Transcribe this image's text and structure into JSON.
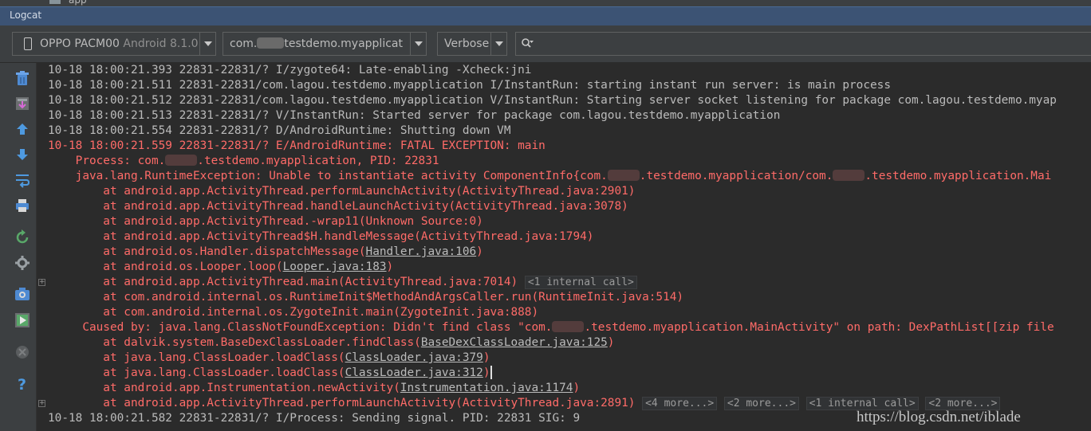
{
  "top_strip": {
    "label": "app"
  },
  "window_title": "Logcat",
  "toolbar": {
    "device": {
      "name": "OPPO PACM00",
      "api": "Android 8.1.0"
    },
    "process": {
      "prefix": "com.",
      "suffix": "testdemo.myapplicat"
    },
    "log_level": "Verbose",
    "search": {
      "value": "",
      "placeholder": ""
    }
  },
  "sidebar": {
    "tools": [
      {
        "name": "trash-icon"
      },
      {
        "name": "scroll-to-end-icon"
      },
      {
        "name": "up-arrow-icon"
      },
      {
        "name": "down-arrow-icon"
      },
      {
        "name": "soft-wraps-icon"
      },
      {
        "name": "print-icon"
      },
      {
        "name": "restart-icon"
      },
      {
        "name": "gear-icon"
      },
      {
        "name": "screenshot-icon"
      },
      {
        "name": "screen-record-icon"
      },
      {
        "name": "close-icon"
      },
      {
        "name": "help-icon"
      }
    ]
  },
  "colors": {
    "error": "#ff6b68",
    "info": "#bbbbbb",
    "background": "#2b2b2b",
    "title_bar": "#3c5374"
  },
  "log_lines": [
    {
      "level": "I",
      "segments": [
        {
          "t": "10-18 18:00:21.393 22831-22831/? I/zygote64: Late-enabling -Xcheck:jni"
        }
      ]
    },
    {
      "level": "I",
      "segments": [
        {
          "t": "10-18 18:00:21.511 22831-22831/com.lagou.testdemo.myapplication I/InstantRun: starting instant run server: is main process"
        }
      ]
    },
    {
      "level": "V",
      "segments": [
        {
          "t": "10-18 18:00:21.512 22831-22831/com.lagou.testdemo.myapplication V/InstantRun: Starting server socket listening for package com.lagou.testdemo.myap"
        }
      ]
    },
    {
      "level": "V",
      "segments": [
        {
          "t": "10-18 18:00:21.513 22831-22831/? V/InstantRun: Started server for package com.lagou.testdemo.myapplication"
        }
      ]
    },
    {
      "level": "D",
      "segments": [
        {
          "t": "10-18 18:00:21.554 22831-22831/? D/AndroidRuntime: Shutting down VM"
        }
      ]
    },
    {
      "level": "E",
      "segments": [
        {
          "t": "10-18 18:00:21.559 22831-22831/? E/AndroidRuntime: FATAL EXCEPTION: main"
        }
      ]
    },
    {
      "level": "E",
      "segments": [
        {
          "t": "    Process: com."
        },
        {
          "redacted": true
        },
        {
          "t": ".testdemo.myapplication, PID: 22831"
        }
      ]
    },
    {
      "level": "E",
      "segments": [
        {
          "t": "    java.lang.RuntimeException: Unable to instantiate activity ComponentInfo{com."
        },
        {
          "redacted": true
        },
        {
          "t": ".testdemo.myapplication/com."
        },
        {
          "redacted": true
        },
        {
          "t": ".testdemo.myapplication.Mai"
        }
      ]
    },
    {
      "level": "E",
      "segments": [
        {
          "t": "        at android.app.ActivityThread.performLaunchActivity(ActivityThread.java:2901)"
        }
      ]
    },
    {
      "level": "E",
      "segments": [
        {
          "t": "        at android.app.ActivityThread.handleLaunchActivity(ActivityThread.java:3078)"
        }
      ]
    },
    {
      "level": "E",
      "segments": [
        {
          "t": "        at android.app.ActivityThread.-wrap11(Unknown Source:0)"
        }
      ]
    },
    {
      "level": "E",
      "segments": [
        {
          "t": "        at android.app.ActivityThread$H.handleMessage(ActivityThread.java:1794)"
        }
      ]
    },
    {
      "level": "E",
      "segments": [
        {
          "t": "        at android.os.Handler.dispatchMessage("
        },
        {
          "t": "Handler.java:106",
          "link": true
        },
        {
          "t": ")"
        }
      ]
    },
    {
      "level": "E",
      "segments": [
        {
          "t": "        at android.os.Looper.loop("
        },
        {
          "t": "Looper.java:183",
          "link": true
        },
        {
          "t": ")"
        }
      ]
    },
    {
      "level": "E",
      "fold": true,
      "segments": [
        {
          "t": "        at android.app.ActivityThread.main(ActivityThread.java:7014) "
        },
        {
          "t": "<1 internal call>",
          "tag": true
        }
      ]
    },
    {
      "level": "E",
      "segments": [
        {
          "t": "        at com.android.internal.os.RuntimeInit$MethodAndArgsCaller.run(RuntimeInit.java:514)"
        }
      ]
    },
    {
      "level": "E",
      "segments": [
        {
          "t": "        at com.android.internal.os.ZygoteInit.main(ZygoteInit.java:888)"
        }
      ]
    },
    {
      "level": "E",
      "segments": [
        {
          "t": "     Caused by: java.lang.ClassNotFoundException: Didn't find class \"com."
        },
        {
          "redacted": true
        },
        {
          "t": ".testdemo.myapplication.MainActivity\" on path: DexPathList[[zip file"
        }
      ]
    },
    {
      "level": "E",
      "segments": [
        {
          "t": "        at dalvik.system.BaseDexClassLoader.findClass("
        },
        {
          "t": "BaseDexClassLoader.java:125",
          "link": true
        },
        {
          "t": ")"
        }
      ]
    },
    {
      "level": "E",
      "segments": [
        {
          "t": "        at java.lang.ClassLoader.loadClass("
        },
        {
          "t": "ClassLoader.java:379",
          "link": true
        },
        {
          "t": ")"
        }
      ]
    },
    {
      "level": "E",
      "segments": [
        {
          "t": "        at java.lang.ClassLoader.loadClass("
        },
        {
          "t": "ClassLoader.java:312",
          "link": true
        },
        {
          "t": ")"
        },
        {
          "caret": true
        }
      ]
    },
    {
      "level": "E",
      "segments": [
        {
          "t": "        at android.app.Instrumentation.newActivity("
        },
        {
          "t": "Instrumentation.java:1174",
          "link": true
        },
        {
          "t": ")"
        }
      ]
    },
    {
      "level": "E",
      "fold": true,
      "segments": [
        {
          "t": "        at android.app.ActivityThread.performLaunchActivity(ActivityThread.java:2891) "
        },
        {
          "t": "<4 more...>",
          "tag": true
        },
        {
          "t": " "
        },
        {
          "t": "<2 more...>",
          "tag": true
        },
        {
          "t": " "
        },
        {
          "t": "<1 internal call>",
          "tag": true
        },
        {
          "t": " "
        },
        {
          "t": "<2 more...>",
          "tag": true
        }
      ]
    },
    {
      "level": "I",
      "segments": [
        {
          "t": "10-18 18:00:21.582 22831-22831/? I/Process: Sending signal. PID: 22831 SIG: 9"
        }
      ]
    }
  ],
  "watermark": "https://blog.csdn.net/iblade"
}
